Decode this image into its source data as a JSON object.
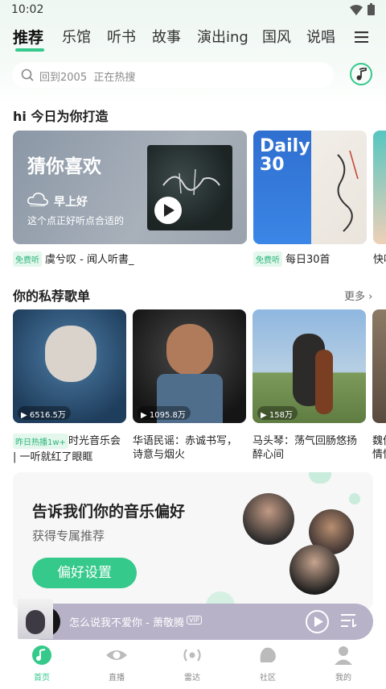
{
  "status": {
    "time": "10:02"
  },
  "tabs": [
    "推荐",
    "乐馆",
    "听书",
    "故事",
    "演出ing",
    "国风",
    "说唱"
  ],
  "search": {
    "placeholder": "回到2005",
    "hint": "正在热搜"
  },
  "section1": {
    "title": "hi 今日为你打造",
    "guess": {
      "title": "猜你喜欢",
      "weather": "早上好",
      "desc": "这个点正好听点合适的"
    },
    "cards": [
      {
        "tag": "免费听",
        "caption": "虞兮叹 - 闻人听書_"
      },
      {
        "tag": "免费听",
        "caption": "每日30首",
        "cover_title": "Daily 30"
      },
      {
        "caption": "快吧"
      }
    ]
  },
  "section2": {
    "title": "你的私荐歌单",
    "more": "更多",
    "playlists": [
      {
        "count": "6516.5万",
        "tag": "昨日热播1w+",
        "line1": "时光音乐会",
        "line2": "| 一听就红了眼眶"
      },
      {
        "count": "1095.8万",
        "line1": "华语民谣：赤诚书写，",
        "line2": "诗意与烟火"
      },
      {
        "count": "158万",
        "line1": "马头琴：荡气回肠悠扬",
        "line2": "醉心间"
      },
      {
        "line1": "魏俊",
        "line2": "情怀"
      }
    ]
  },
  "pref": {
    "title": "告诉我们你的音乐偏好",
    "sub": "获得专属推荐",
    "button": "偏好设置"
  },
  "player": {
    "song": "怎么说我不爱你 - 萧敬腾",
    "badge": "VIP"
  },
  "nav": [
    "首页",
    "直播",
    "雷达",
    "社区",
    "我的"
  ],
  "colors": {
    "accent": "#35c98b",
    "player_bg": "#b7b2c8"
  }
}
